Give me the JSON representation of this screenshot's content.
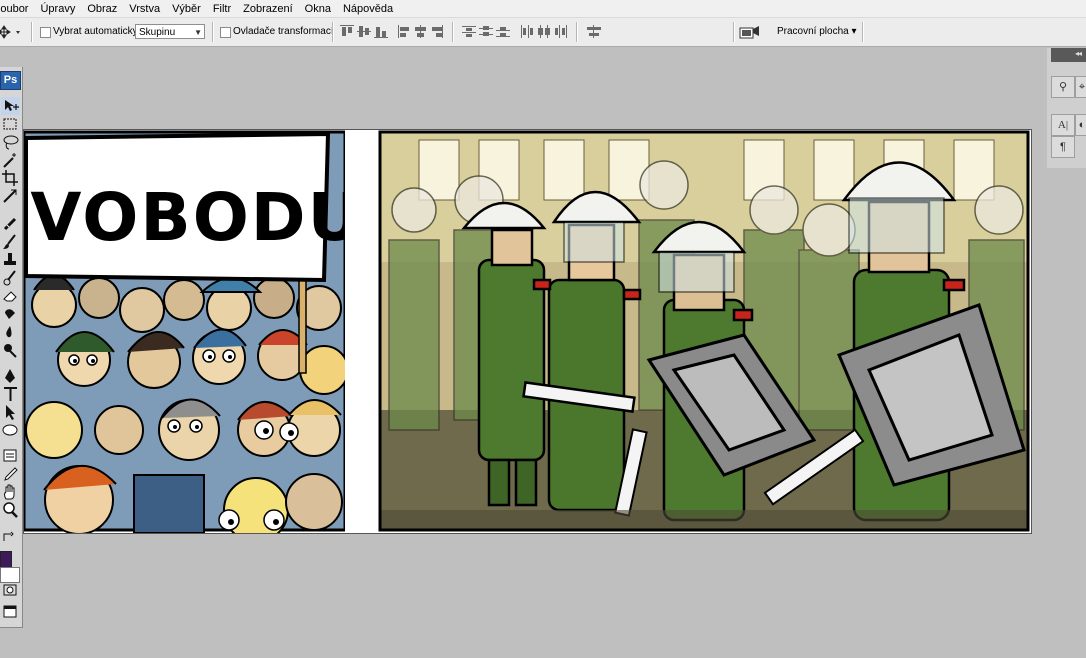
{
  "menu": [
    "Soubor",
    "Úpravy",
    "Obraz",
    "Vrstva",
    "Výběr",
    "Filtr",
    "Zobrazení",
    "Okna",
    "Nápověda"
  ],
  "options": {
    "auto_select_label": "Vybrat automaticky:",
    "auto_select_value": "Skupinu",
    "transform_label": "Ovladače transformací",
    "workspace_label": "Pracovní plocha ▾"
  },
  "tools_panel": {
    "logo": "Ps"
  },
  "dock": {
    "collapse": "◂◂"
  },
  "comic": {
    "sign_text": "SVOBODU"
  },
  "colors": {
    "foreground": "#3e1a5c",
    "background": "#ffffff",
    "ui_gray": "#bfbfbf"
  }
}
